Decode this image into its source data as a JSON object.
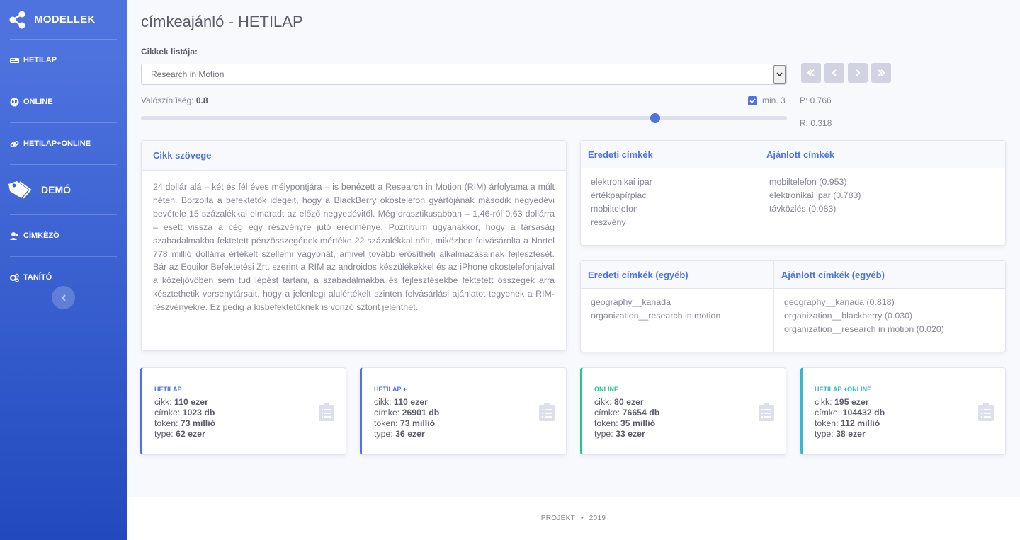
{
  "sidebar": {
    "brand": "MODELLEK",
    "items": [
      {
        "label": "HETILAP",
        "icon": "newspaper-icon"
      },
      {
        "label": "ONLINE",
        "icon": "globe-icon"
      },
      {
        "label": "HETILAP+ONLINE",
        "icon": "link-icon"
      }
    ],
    "demo": "DEMÓ",
    "items2": [
      {
        "label": "CÍMKÉZŐ",
        "icon": "users-icon"
      },
      {
        "label": "TANÍTÓ",
        "icon": "cogs-icon"
      }
    ]
  },
  "page": {
    "title": "címkeajánló - HETILAP",
    "list_label": "Cikkek listája:",
    "selected_article": "Research in Motion",
    "prob_label": "Valószínűség:",
    "prob_value": "0.8",
    "prob_level": 0.8,
    "min_label": "min. 3",
    "min_checked": true,
    "p_label": "P: 0.766",
    "r_label": "R: 0.318"
  },
  "article": {
    "header": "Cikk szövege",
    "text": "24 dollár alá – két és fél éves mélypontjára – is benézett a Research in Motion (RIM) árfolyama a múlt héten. Borzolta a befektetők idegeit, hogy a BlackBerry okostelefon gyártójának második negyedévi bevétele 15 százalékkal elmaradt az előző negyedévitől. Még drasztikusabban – 1,46-ról 0,63 dollárra – esett vissza a cég egy részvényre jutó eredménye. Pozitívum ugyanakkor, hogy a társaság szabadalmakba fektetett pénzösszegének mértéke 22 százalékkal nőtt, miközben felvásárolta a Nortel 778 millió dollárra értékelt szellemi vagyonát, amivel tovább erősítheti alkalmazásainak fejlesztését. Bár az Equilor Befektetési Zrt. szerint a RIM az androidos készülékekkel és az iPhone okostelefonjaival a közeljövőben sem tud lépést tartani, a szabadalmakba és fejlesztésekbe fektetett összegek arra késztethetik versenytársait, hogy a jelenlegi alulértékelt szinten felvásárlási ajánlatot tegyenek a RIM-részvényekre. Ez pedig a kisbefektetőknek is vonzó sztorit jelenthet."
  },
  "tags": {
    "orig_header": "Eredeti címkék",
    "rec_header": "Ajánlott címkék",
    "orig": [
      "elektronikai ipar",
      "értékpapírpiac",
      "mobiltelefon",
      "részvény"
    ],
    "rec": [
      "mobiltelefon (0.953)",
      "elektronikai ipar (0.783)",
      "távközlés (0.083)"
    ]
  },
  "other_tags": {
    "orig_header": "Eredeti címkék (egyéb)",
    "rec_header": "Ajánlott címkék (egyéb)",
    "orig": [
      "geography__kanada",
      "organization__research in motion"
    ],
    "rec": [
      "geography__kanada (0.818)",
      "organization__blackberry (0.030)",
      "organization__research in motion (0.020)"
    ]
  },
  "stats": [
    {
      "title": "HETILAP",
      "cikk": "110 ezer",
      "cimke": "1023 db",
      "token": "73 millió",
      "type": "62 ezer"
    },
    {
      "title": "HETILAP +",
      "cikk": "110 ezer",
      "cimke": "26901 db",
      "token": "73 millió",
      "type": "36 ezer"
    },
    {
      "title": "ONLINE",
      "cikk": "80 ezer",
      "cimke": "76654 db",
      "token": "35 millió",
      "type": "33 ezer"
    },
    {
      "title": "HETILAP +ONLINE",
      "cikk": "195 ezer",
      "cimke": "104432 db",
      "token": "112 millió",
      "type": "38 ezer"
    }
  ],
  "stat_labels": {
    "cikk": "cikk:",
    "cimke": "címke:",
    "token": "token:",
    "type": "type:"
  },
  "footer": {
    "text": "PROJEKT",
    "year": "2019"
  },
  "colors": {
    "primary": "#4e73df",
    "success": "#1cc88a",
    "info": "#36b9cc"
  }
}
